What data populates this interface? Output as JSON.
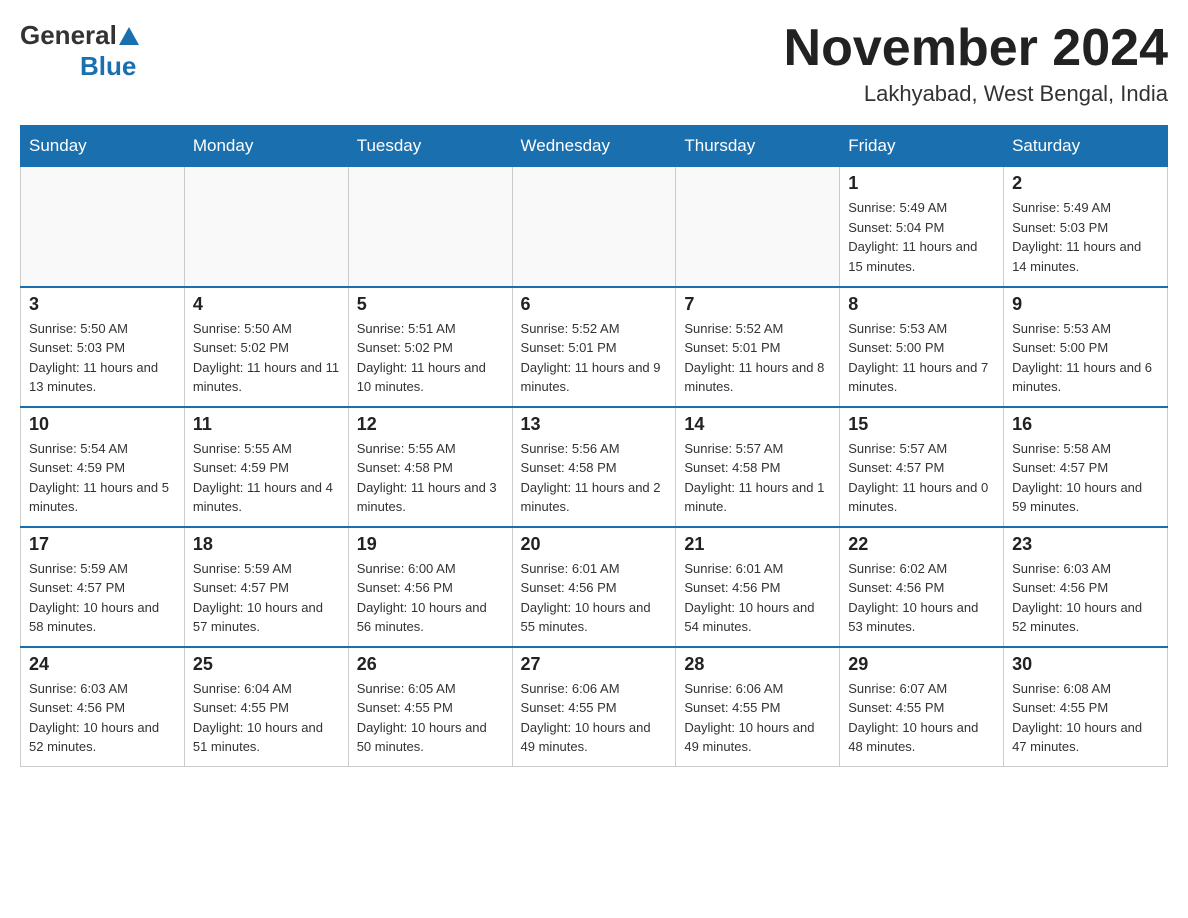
{
  "logo": {
    "general": "General",
    "blue": "Blue"
  },
  "header": {
    "month": "November 2024",
    "location": "Lakhyabad, West Bengal, India"
  },
  "days_of_week": [
    "Sunday",
    "Monday",
    "Tuesday",
    "Wednesday",
    "Thursday",
    "Friday",
    "Saturday"
  ],
  "weeks": [
    [
      {
        "day": "",
        "info": ""
      },
      {
        "day": "",
        "info": ""
      },
      {
        "day": "",
        "info": ""
      },
      {
        "day": "",
        "info": ""
      },
      {
        "day": "",
        "info": ""
      },
      {
        "day": "1",
        "info": "Sunrise: 5:49 AM\nSunset: 5:04 PM\nDaylight: 11 hours and 15 minutes."
      },
      {
        "day": "2",
        "info": "Sunrise: 5:49 AM\nSunset: 5:03 PM\nDaylight: 11 hours and 14 minutes."
      }
    ],
    [
      {
        "day": "3",
        "info": "Sunrise: 5:50 AM\nSunset: 5:03 PM\nDaylight: 11 hours and 13 minutes."
      },
      {
        "day": "4",
        "info": "Sunrise: 5:50 AM\nSunset: 5:02 PM\nDaylight: 11 hours and 11 minutes."
      },
      {
        "day": "5",
        "info": "Sunrise: 5:51 AM\nSunset: 5:02 PM\nDaylight: 11 hours and 10 minutes."
      },
      {
        "day": "6",
        "info": "Sunrise: 5:52 AM\nSunset: 5:01 PM\nDaylight: 11 hours and 9 minutes."
      },
      {
        "day": "7",
        "info": "Sunrise: 5:52 AM\nSunset: 5:01 PM\nDaylight: 11 hours and 8 minutes."
      },
      {
        "day": "8",
        "info": "Sunrise: 5:53 AM\nSunset: 5:00 PM\nDaylight: 11 hours and 7 minutes."
      },
      {
        "day": "9",
        "info": "Sunrise: 5:53 AM\nSunset: 5:00 PM\nDaylight: 11 hours and 6 minutes."
      }
    ],
    [
      {
        "day": "10",
        "info": "Sunrise: 5:54 AM\nSunset: 4:59 PM\nDaylight: 11 hours and 5 minutes."
      },
      {
        "day": "11",
        "info": "Sunrise: 5:55 AM\nSunset: 4:59 PM\nDaylight: 11 hours and 4 minutes."
      },
      {
        "day": "12",
        "info": "Sunrise: 5:55 AM\nSunset: 4:58 PM\nDaylight: 11 hours and 3 minutes."
      },
      {
        "day": "13",
        "info": "Sunrise: 5:56 AM\nSunset: 4:58 PM\nDaylight: 11 hours and 2 minutes."
      },
      {
        "day": "14",
        "info": "Sunrise: 5:57 AM\nSunset: 4:58 PM\nDaylight: 11 hours and 1 minute."
      },
      {
        "day": "15",
        "info": "Sunrise: 5:57 AM\nSunset: 4:57 PM\nDaylight: 11 hours and 0 minutes."
      },
      {
        "day": "16",
        "info": "Sunrise: 5:58 AM\nSunset: 4:57 PM\nDaylight: 10 hours and 59 minutes."
      }
    ],
    [
      {
        "day": "17",
        "info": "Sunrise: 5:59 AM\nSunset: 4:57 PM\nDaylight: 10 hours and 58 minutes."
      },
      {
        "day": "18",
        "info": "Sunrise: 5:59 AM\nSunset: 4:57 PM\nDaylight: 10 hours and 57 minutes."
      },
      {
        "day": "19",
        "info": "Sunrise: 6:00 AM\nSunset: 4:56 PM\nDaylight: 10 hours and 56 minutes."
      },
      {
        "day": "20",
        "info": "Sunrise: 6:01 AM\nSunset: 4:56 PM\nDaylight: 10 hours and 55 minutes."
      },
      {
        "day": "21",
        "info": "Sunrise: 6:01 AM\nSunset: 4:56 PM\nDaylight: 10 hours and 54 minutes."
      },
      {
        "day": "22",
        "info": "Sunrise: 6:02 AM\nSunset: 4:56 PM\nDaylight: 10 hours and 53 minutes."
      },
      {
        "day": "23",
        "info": "Sunrise: 6:03 AM\nSunset: 4:56 PM\nDaylight: 10 hours and 52 minutes."
      }
    ],
    [
      {
        "day": "24",
        "info": "Sunrise: 6:03 AM\nSunset: 4:56 PM\nDaylight: 10 hours and 52 minutes."
      },
      {
        "day": "25",
        "info": "Sunrise: 6:04 AM\nSunset: 4:55 PM\nDaylight: 10 hours and 51 minutes."
      },
      {
        "day": "26",
        "info": "Sunrise: 6:05 AM\nSunset: 4:55 PM\nDaylight: 10 hours and 50 minutes."
      },
      {
        "day": "27",
        "info": "Sunrise: 6:06 AM\nSunset: 4:55 PM\nDaylight: 10 hours and 49 minutes."
      },
      {
        "day": "28",
        "info": "Sunrise: 6:06 AM\nSunset: 4:55 PM\nDaylight: 10 hours and 49 minutes."
      },
      {
        "day": "29",
        "info": "Sunrise: 6:07 AM\nSunset: 4:55 PM\nDaylight: 10 hours and 48 minutes."
      },
      {
        "day": "30",
        "info": "Sunrise: 6:08 AM\nSunset: 4:55 PM\nDaylight: 10 hours and 47 minutes."
      }
    ]
  ]
}
